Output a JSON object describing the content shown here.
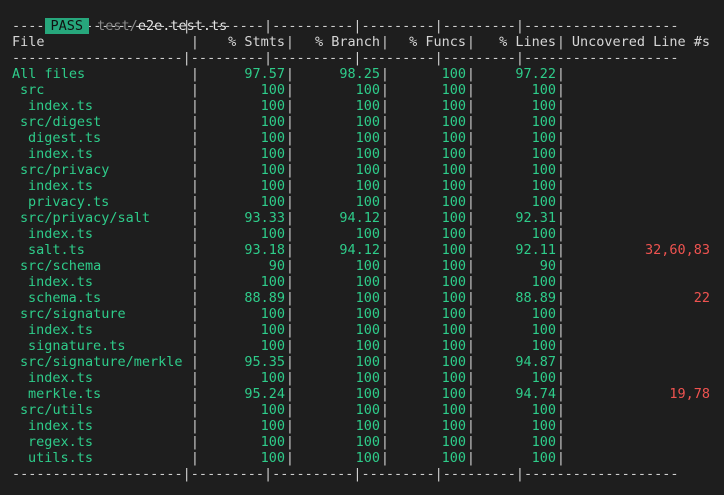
{
  "header": {
    "status": "PASS",
    "path_dim": "test/",
    "path_file": "e2e.test.ts"
  },
  "columns": {
    "file": "File",
    "stmts": "% Stmts",
    "branch": "% Branch",
    "funcs": "% Funcs",
    "lines": "% Lines",
    "uncovered": "Uncovered Line #s"
  },
  "rows": [
    {
      "file": "All files",
      "indent": 0,
      "stmts": "97.57",
      "branch": "98.25",
      "funcs": "100",
      "lines": "97.22",
      "uncovered": ""
    },
    {
      "file": "src",
      "indent": 1,
      "stmts": "100",
      "branch": "100",
      "funcs": "100",
      "lines": "100",
      "uncovered": ""
    },
    {
      "file": "index.ts",
      "indent": 2,
      "stmts": "100",
      "branch": "100",
      "funcs": "100",
      "lines": "100",
      "uncovered": ""
    },
    {
      "file": "src/digest",
      "indent": 1,
      "stmts": "100",
      "branch": "100",
      "funcs": "100",
      "lines": "100",
      "uncovered": ""
    },
    {
      "file": "digest.ts",
      "indent": 2,
      "stmts": "100",
      "branch": "100",
      "funcs": "100",
      "lines": "100",
      "uncovered": ""
    },
    {
      "file": "index.ts",
      "indent": 2,
      "stmts": "100",
      "branch": "100",
      "funcs": "100",
      "lines": "100",
      "uncovered": ""
    },
    {
      "file": "src/privacy",
      "indent": 1,
      "stmts": "100",
      "branch": "100",
      "funcs": "100",
      "lines": "100",
      "uncovered": ""
    },
    {
      "file": "index.ts",
      "indent": 2,
      "stmts": "100",
      "branch": "100",
      "funcs": "100",
      "lines": "100",
      "uncovered": ""
    },
    {
      "file": "privacy.ts",
      "indent": 2,
      "stmts": "100",
      "branch": "100",
      "funcs": "100",
      "lines": "100",
      "uncovered": ""
    },
    {
      "file": "src/privacy/salt",
      "indent": 1,
      "stmts": "93.33",
      "branch": "94.12",
      "funcs": "100",
      "lines": "92.31",
      "uncovered": ""
    },
    {
      "file": "index.ts",
      "indent": 2,
      "stmts": "100",
      "branch": "100",
      "funcs": "100",
      "lines": "100",
      "uncovered": ""
    },
    {
      "file": "salt.ts",
      "indent": 2,
      "stmts": "93.18",
      "branch": "94.12",
      "funcs": "100",
      "lines": "92.11",
      "uncovered": "32,60,83"
    },
    {
      "file": "src/schema",
      "indent": 1,
      "stmts": "90",
      "branch": "100",
      "funcs": "100",
      "lines": "90",
      "uncovered": ""
    },
    {
      "file": "index.ts",
      "indent": 2,
      "stmts": "100",
      "branch": "100",
      "funcs": "100",
      "lines": "100",
      "uncovered": ""
    },
    {
      "file": "schema.ts",
      "indent": 2,
      "stmts": "88.89",
      "branch": "100",
      "funcs": "100",
      "lines": "88.89",
      "uncovered": "22"
    },
    {
      "file": "src/signature",
      "indent": 1,
      "stmts": "100",
      "branch": "100",
      "funcs": "100",
      "lines": "100",
      "uncovered": ""
    },
    {
      "file": "index.ts",
      "indent": 2,
      "stmts": "100",
      "branch": "100",
      "funcs": "100",
      "lines": "100",
      "uncovered": ""
    },
    {
      "file": "signature.ts",
      "indent": 2,
      "stmts": "100",
      "branch": "100",
      "funcs": "100",
      "lines": "100",
      "uncovered": ""
    },
    {
      "file": "src/signature/merkle",
      "indent": 1,
      "stmts": "95.35",
      "branch": "100",
      "funcs": "100",
      "lines": "94.87",
      "uncovered": ""
    },
    {
      "file": "index.ts",
      "indent": 2,
      "stmts": "100",
      "branch": "100",
      "funcs": "100",
      "lines": "100",
      "uncovered": ""
    },
    {
      "file": "merkle.ts",
      "indent": 2,
      "stmts": "95.24",
      "branch": "100",
      "funcs": "100",
      "lines": "94.74",
      "uncovered": "19,78"
    },
    {
      "file": "src/utils",
      "indent": 1,
      "stmts": "100",
      "branch": "100",
      "funcs": "100",
      "lines": "100",
      "uncovered": ""
    },
    {
      "file": "index.ts",
      "indent": 2,
      "stmts": "100",
      "branch": "100",
      "funcs": "100",
      "lines": "100",
      "uncovered": ""
    },
    {
      "file": "regex.ts",
      "indent": 2,
      "stmts": "100",
      "branch": "100",
      "funcs": "100",
      "lines": "100",
      "uncovered": ""
    },
    {
      "file": "utils.ts",
      "indent": 2,
      "stmts": "100",
      "branch": "100",
      "funcs": "100",
      "lines": "100",
      "uncovered": ""
    }
  ],
  "colors": {
    "background": "#1e1e1e",
    "pass_badge": "#27a77c",
    "covered": "#2ecc8a",
    "uncovered": "#ef5350"
  }
}
